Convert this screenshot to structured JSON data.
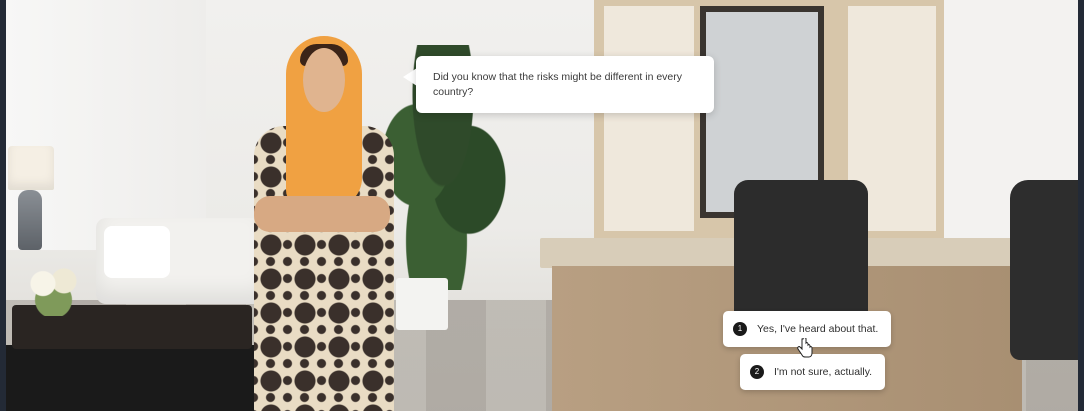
{
  "speech_bubble": {
    "text": "Did you know that the risks might be different in every country?"
  },
  "choices": [
    {
      "number": "1",
      "label": "Yes, I've heard about that."
    },
    {
      "number": "2",
      "label": "I'm not sure, actually."
    }
  ],
  "colors": {
    "scarf": "#f0a142",
    "bubble_bg": "#ffffff",
    "choice_badge": "#1a1a1a"
  }
}
